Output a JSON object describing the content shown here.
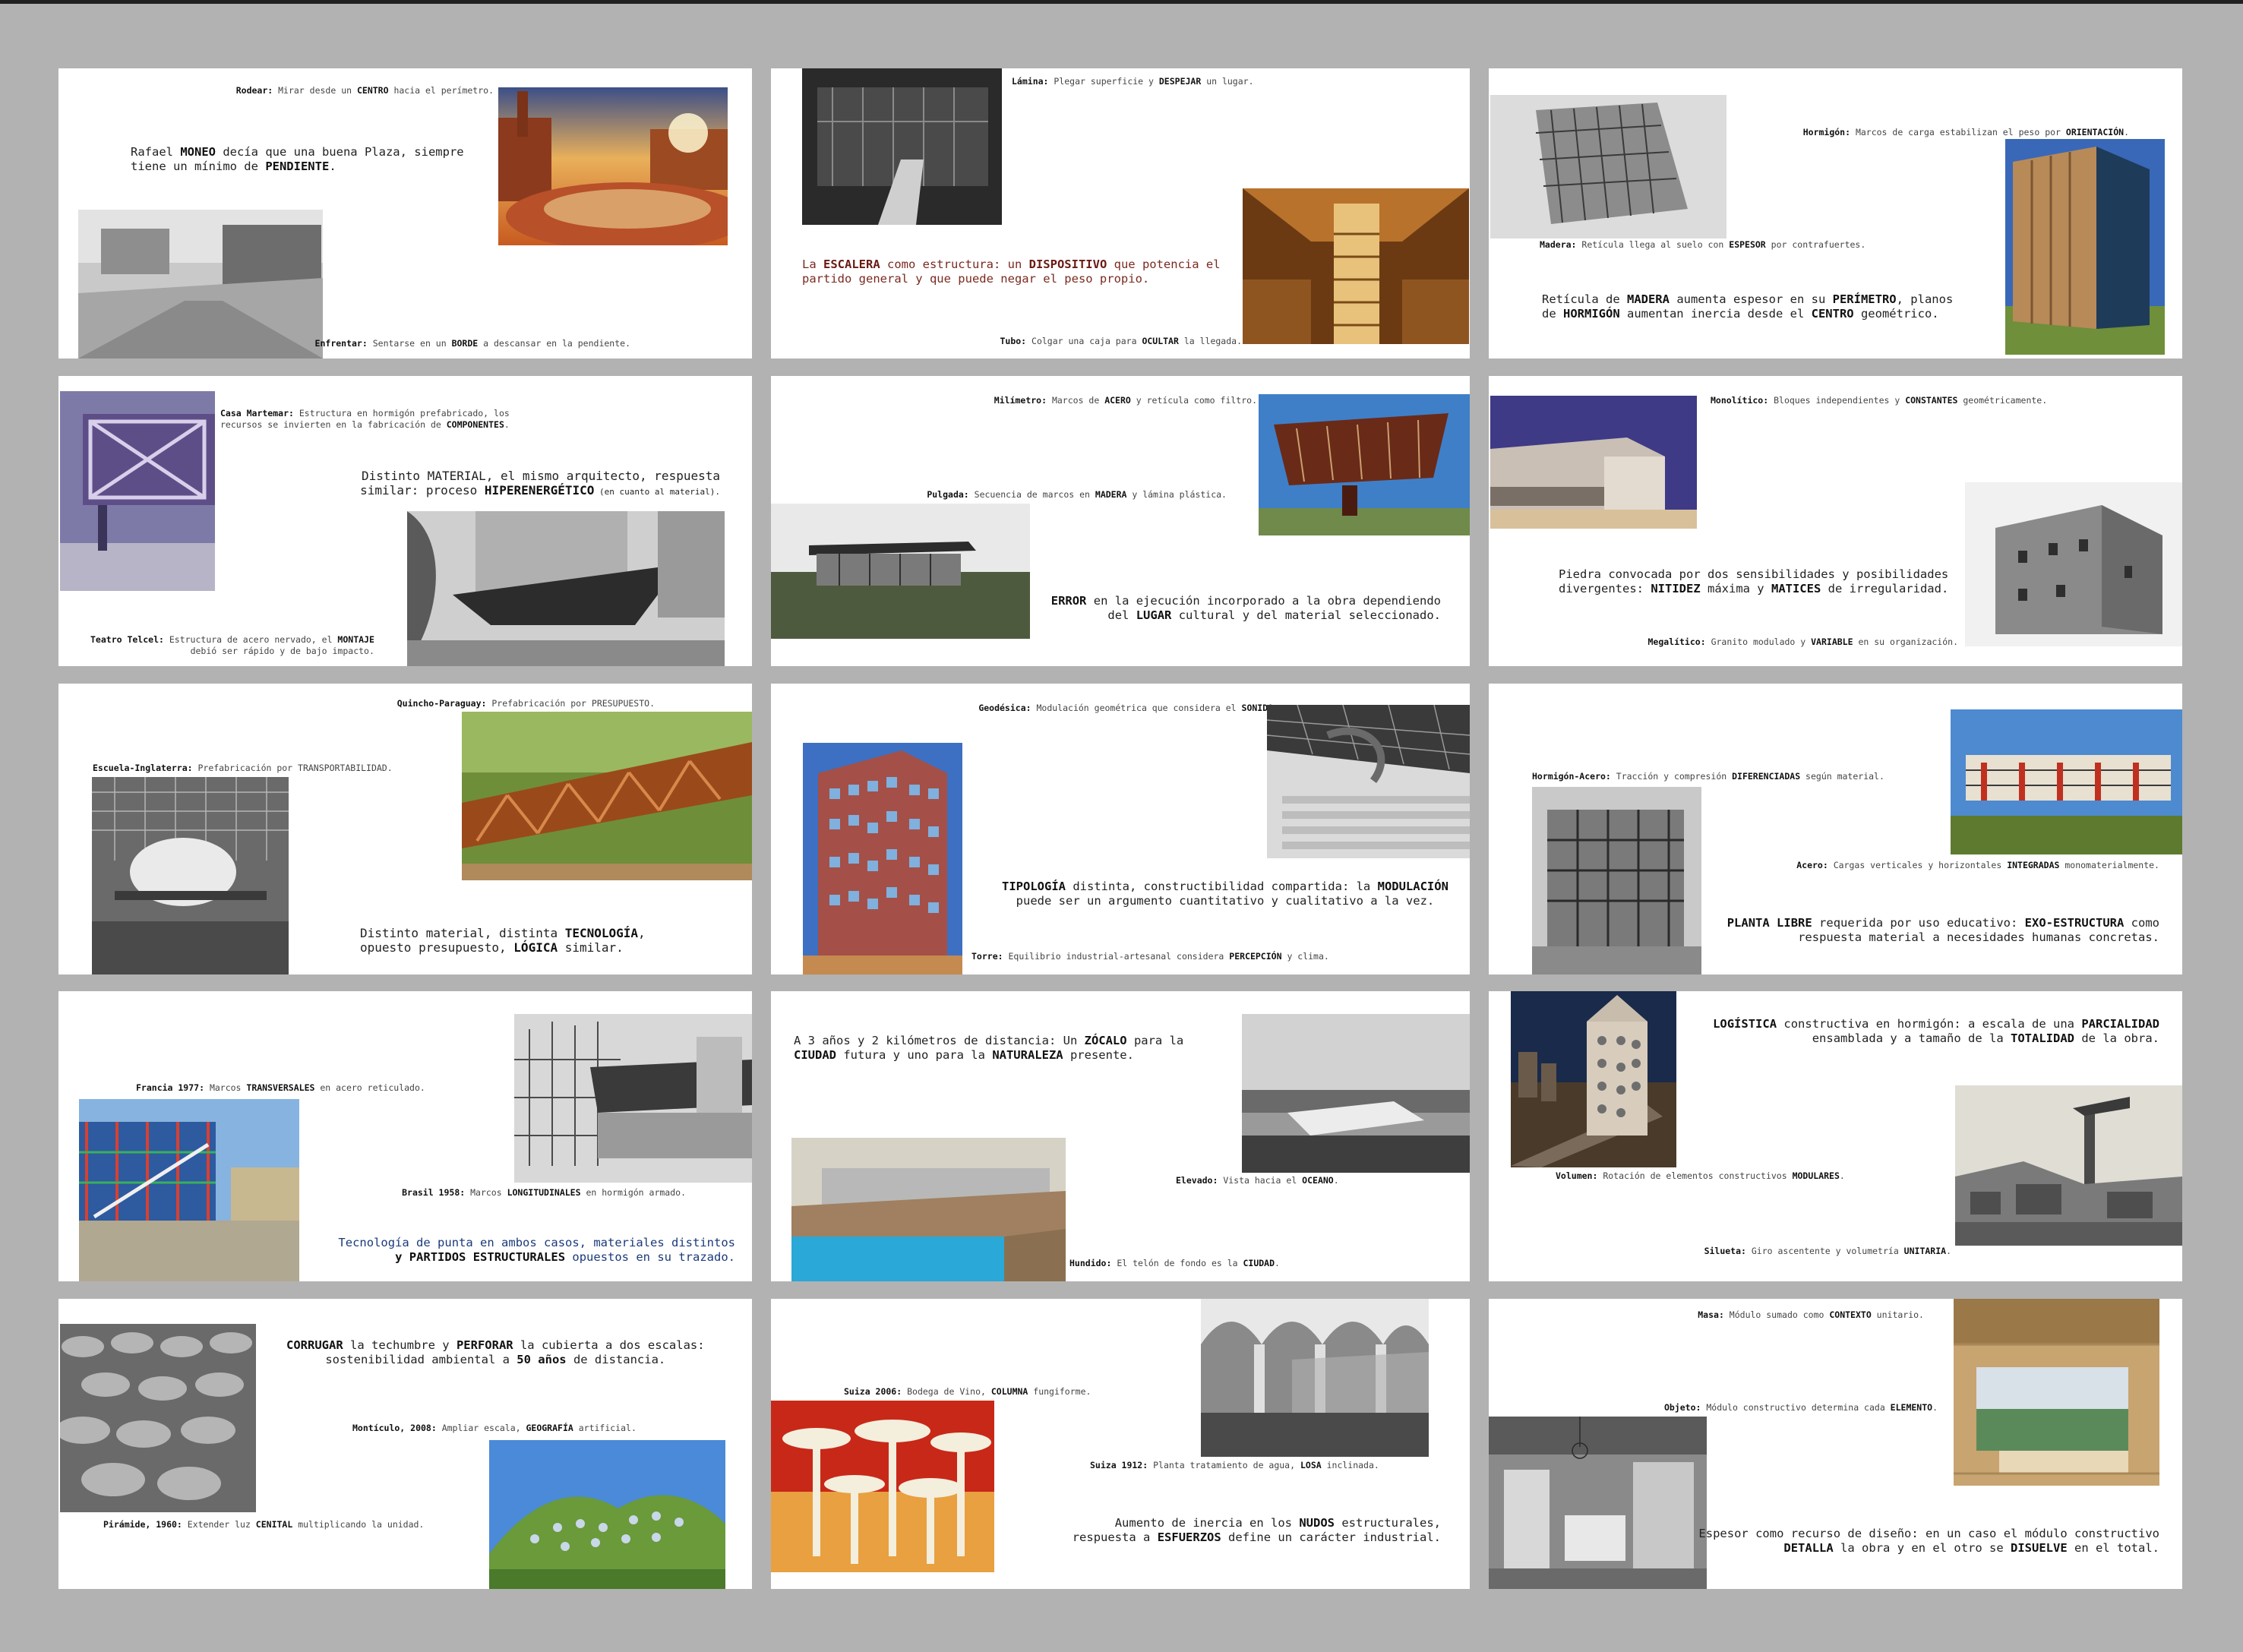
{
  "panels": [
    {
      "captions": [
        {
          "k": "Rodear:",
          "t": " Mirar desde un ",
          "b": "CENTRO",
          "t2": " hacia el perímetro."
        },
        {
          "k": "Enfrentar:",
          "t": " Sentarse en un ",
          "b": "BORDE",
          "t2": " a descansar en la pendiente."
        }
      ],
      "text": {
        "l1": "Rafael ",
        "b1": "MONEO",
        "l2": " decía que una buena Plaza, siempre",
        "l3": "tiene un mínimo de ",
        "b2": "PENDIENTE",
        "l4": "."
      }
    },
    {
      "captions": [
        {
          "k": "Lámina:",
          "t": " Plegar superficie y ",
          "b": "DESPEJAR",
          "t2": " un lugar."
        },
        {
          "k": "Tubo:",
          "t": " Colgar una caja para ",
          "b": "OCULTAR",
          "t2": " la llegada."
        }
      ],
      "text": {
        "l1": "La ",
        "b1": "ESCALERA",
        "l2": " como estructura: un ",
        "b2": "DISPOSITIVO",
        "l3": " que potencia el",
        "l4": "partido general y que puede negar el peso propio."
      }
    },
    {
      "captions": [
        {
          "k": "Hormigón:",
          "t": " Marcos de carga estabilizan el peso por ",
          "b": "ORIENTACIÓN",
          "t2": "."
        },
        {
          "k": "Madera:",
          "t": " Retícula llega al suelo con ",
          "b": "ESPESOR",
          "t2": " por contrafuertes."
        }
      ],
      "text": {
        "l1": "Retícula de ",
        "b1": "MADERA",
        "l2": " aumenta espesor en su ",
        "b2": "PERÍMETRO",
        "l3": ", planos",
        "l4": "de ",
        "b3": "HORMIGÓN",
        "l5": " aumentan inercia desde el ",
        "b4": "CENTRO",
        "l6": " geométrico."
      }
    },
    {
      "captions": [
        {
          "k": "Casa Martemar:",
          "t": " Estructura en hormigón prefabricado, los",
          "t3": "recursos se invierten en la fabricación de ",
          "b": "COMPONENTES",
          "t2": "."
        },
        {
          "k": "Teatro Telcel:",
          "t": " Estructura de acero nervado, el ",
          "b": "MONTAJE",
          "t3": "debió ser rápido y de bajo impacto."
        }
      ],
      "text": {
        "l1": "Distinto MATERIAL, el mismo arquitecto, respuesta",
        "l2": "similar: proceso ",
        "b1": "HIPERENERGÉTICO",
        "l3": " (en cuanto al material)."
      }
    },
    {
      "captions": [
        {
          "k": "Milímetro:",
          "t": " Marcos de ",
          "b": "ACERO",
          "t2": " y retícula como filtro."
        },
        {
          "k": "Pulgada:",
          "t": " Secuencia de marcos en ",
          "b": "MADERA",
          "t2": " y lámina plástica."
        }
      ],
      "text": {
        "b1": "ERROR",
        "l1": " en la ejecución incorporado a la obra dependiendo",
        "l2": "del ",
        "b2": "LUGAR",
        "l3": " cultural y del material seleccionado."
      }
    },
    {
      "captions": [
        {
          "k": "Monolítico:",
          "t": " Bloques independientes y ",
          "b": "CONSTANTES",
          "t2": " geométricamente."
        },
        {
          "k": "Megalítico:",
          "t": " Granito modulado y ",
          "b": "VARIABLE",
          "t2": " en su organización."
        }
      ],
      "text": {
        "l1": "Piedra convocada por dos sensibilidades y posibilidades",
        "l2": "divergentes: ",
        "b1": "NITIDEZ",
        "l3": " máxima y ",
        "b2": "MATICES",
        "l4": " de irregularidad."
      }
    },
    {
      "captions": [
        {
          "k": "Quincho-Paraguay:",
          "t": " Prefabricación por PRESUPUESTO."
        },
        {
          "k": "Escuela-Inglaterra:",
          "t": " Prefabricación por TRANSPORTABILIDAD."
        }
      ],
      "text": {
        "l1": "Distinto material, distinta ",
        "b1": "TECNOLOGÍA",
        "l2": ",",
        "l3": "opuesto presupuesto, ",
        "b2": "LÓGICA",
        "l4": " similar."
      }
    },
    {
      "captions": [
        {
          "k": "Geodésica:",
          "t": " Modulación geométrica que considera el ",
          "b": "SONIDO",
          "t2": "."
        },
        {
          "k": "Torre:",
          "t": " Equilibrio industrial-artesanal considera ",
          "b": "PERCEPCIÓN",
          "t2": " y clima."
        }
      ],
      "text": {
        "b1": "TIPOLOGÍA",
        "l1": " distinta, constructibilidad compartida: la ",
        "b2": "MODULACIÓN",
        "l2": "puede ser un argumento cuantitativo y cualitativo a la vez."
      }
    },
    {
      "captions": [
        {
          "k": "Hormigón-Acero:",
          "t": " Tracción y compresión ",
          "b": "DIFERENCIADAS",
          "t2": " según material."
        },
        {
          "k": "Acero:",
          "t": " Cargas verticales y horizontales ",
          "b": "INTEGRADAS",
          "t2": " monomaterialmente."
        }
      ],
      "text": {
        "b1": "PLANTA LIBRE",
        "l1": " requerida por uso educativo: ",
        "b2": "EXO-ESTRUCTURA",
        "l2": " como",
        "l3": "respuesta material a necesidades humanas concretas."
      }
    },
    {
      "captions": [
        {
          "k": "Francia 1977:",
          "t": " Marcos ",
          "b": "TRANSVERSALES",
          "t2": " en acero reticulado."
        },
        {
          "k": "Brasil 1958:",
          "t": " Marcos ",
          "b": "LONGITUDINALES",
          "t2": " en hormigón armado."
        }
      ],
      "text": {
        "l1": "Tecnología de punta en ambos casos, materiales distintos",
        "b1": "y PARTIDOS ESTRUCTURALES",
        "l2": " opuestos en su trazado."
      }
    },
    {
      "captions": [
        {
          "k": "Elevado:",
          "t": " Vista hacia el ",
          "b": "OCEANO",
          "t2": "."
        },
        {
          "k": "Hundido:",
          "t": " El telón de fondo es la ",
          "b": "CIUDAD",
          "t2": "."
        }
      ],
      "text": {
        "l1": "A 3 años y 2 kilómetros de distancia: Un ",
        "b1": "ZÓCALO",
        "l2": " para la",
        "b2": "CIUDAD",
        "l3": " futura y uno para la ",
        "b3": "NATURALEZA",
        "l4": " presente."
      }
    },
    {
      "captions": [
        {
          "k": "Volumen:",
          "t": " Rotación de elementos constructivos ",
          "b": "MODULARES",
          "t2": "."
        },
        {
          "k": "Silueta:",
          "t": " Giro ascentente y volumetría ",
          "b": "UNITARIA",
          "t2": "."
        }
      ],
      "text": {
        "b1": "LOGÍSTICA",
        "l1": " constructiva en hormigón: a escala de una ",
        "b2": "PARCIALIDAD",
        "l2": "ensamblada y a tamaño de la ",
        "b3": "TOTALIDAD",
        "l3": " de la obra."
      }
    },
    {
      "captions": [
        {
          "k": "Montículo, 2008:",
          "t": " Ampliar escala, ",
          "b": "GEOGRAFÍA",
          "t2": " artificial."
        },
        {
          "k": "Pirámide, 1960:",
          "t": " Extender luz ",
          "b": "CENITAL",
          "t2": " multiplicando la unidad."
        }
      ],
      "text": {
        "b1": "CORRUGAR",
        "l1": " la techumbre y ",
        "b2": "PERFORAR",
        "l2": " la cubierta a dos escalas:",
        "l3": "sostenibilidad ambiental a ",
        "b3": "50 años",
        "l4": " de distancia."
      }
    },
    {
      "captions": [
        {
          "k": "Suiza 2006:",
          "t": " Bodega de Vino, ",
          "b": "COLUMNA",
          "t2": " fungiforme."
        },
        {
          "k": "Suiza 1912:",
          "t": " Planta tratamiento de agua, ",
          "b": "LOSA",
          "t2": " inclinada."
        }
      ],
      "text": {
        "l1": "Aumento de inercia en los ",
        "b1": "NUDOS",
        "l2": " estructurales,",
        "l3": "respuesta a ",
        "b2": "ESFUERZOS",
        "l4": " define un carácter industrial."
      }
    },
    {
      "captions": [
        {
          "k": "Masa:",
          "t": " Módulo sumado como ",
          "b": "CONTEXTO",
          "t2": " unitario."
        },
        {
          "k": "Objeto:",
          "t": " Módulo constructivo determina cada ",
          "b": "ELEMENTO",
          "t2": "."
        }
      ],
      "text": {
        "l1": "Espesor como recurso de diseño: en un caso el módulo constructivo",
        "b1": "DETALLA",
        "l2": " la obra y en el otro se ",
        "b2": "DISUELVE",
        "l3": " en el total."
      }
    }
  ]
}
